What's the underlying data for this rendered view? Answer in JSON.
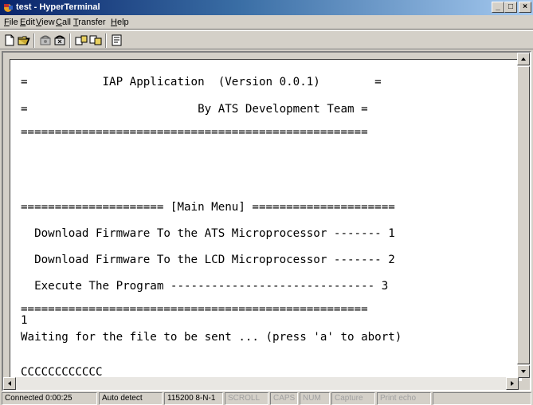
{
  "window": {
    "title": "test - HyperTerminal",
    "minimize": "_",
    "maximize": "□",
    "close": "×"
  },
  "menu": {
    "items": [
      {
        "label": "File",
        "accel": "F",
        "rest": "ile"
      },
      {
        "label": "Edit",
        "accel": "E",
        "rest": "dit"
      },
      {
        "label": "View",
        "accel": "V",
        "rest": "iew"
      },
      {
        "label": "Call",
        "accel": "C",
        "rest": "all"
      },
      {
        "label": "Transfer",
        "accel": "T",
        "rest": "ransfer"
      },
      {
        "label": "Help",
        "accel": "H",
        "rest": "elp"
      }
    ]
  },
  "toolbar": {
    "buttons": [
      "new-icon",
      "open-icon",
      "call-icon",
      "disconnect-icon",
      "send-icon",
      "receive-icon",
      "properties-icon"
    ]
  },
  "terminal": {
    "lines": [
      "=           IAP Application  (Version 0.0.1)        =",
      "=                         By ATS Development Team =",
      "===================================================",
      "===================== [Main Menu] =====================",
      "  Download Firmware To the ATS Microprocessor ------- 1",
      "  Download Firmware To the LCD Microprocessor ------- 2",
      "  Execute The Program ------------------------------ 3",
      "===================================================",
      "1",
      "Waiting for the file to be sent ... (press 'a' to abort)",
      "CCCCCCCCCCCC_"
    ]
  },
  "status": {
    "connected": "Connected 0:00:25",
    "detect": "Auto detect",
    "port": "115200 8-N-1",
    "scroll": "SCROLL",
    "caps": "CAPS",
    "num": "NUM",
    "capture": "Capture",
    "print_echo": "Print echo"
  },
  "colors": {
    "title_start": "#0a246a",
    "title_end": "#a6caf0",
    "chrome": "#d4d0c8"
  }
}
